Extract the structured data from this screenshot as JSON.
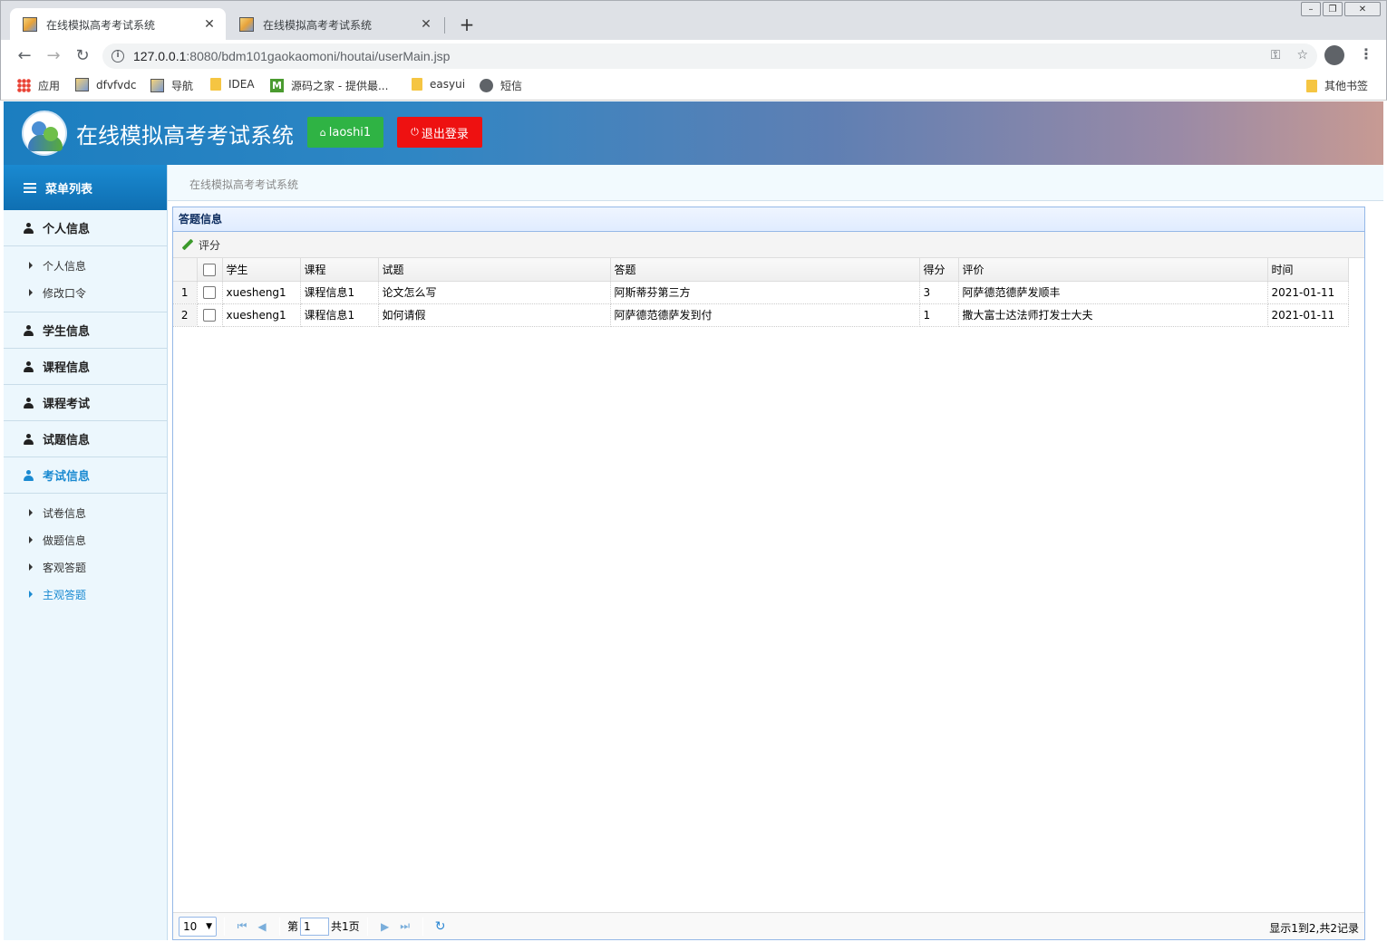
{
  "browser": {
    "tabs": [
      {
        "title": "在线模拟高考考试系统",
        "active": true
      },
      {
        "title": "在线模拟高考考试系统",
        "active": false
      }
    ],
    "url_host": "127.0.0.1",
    "url_rest": ":8080/bdm101gaokaomoni/houtai/userMain.jsp",
    "bookmarks": [
      {
        "label": "应用",
        "icon": "apps-icon"
      },
      {
        "label": "dfvfvdc",
        "icon": "page-icon"
      },
      {
        "label": "导航",
        "icon": "page-icon"
      },
      {
        "label": "IDEA",
        "icon": "folder-icon"
      },
      {
        "label": "源码之家 - 提供最...",
        "icon": "m-icon"
      },
      {
        "label": "easyui",
        "icon": "folder-icon"
      },
      {
        "label": "短信",
        "icon": "globe-icon"
      }
    ],
    "other_bookmarks": "其他书签"
  },
  "header": {
    "title": "在线模拟高考考试系统",
    "user_label": "laoshi1",
    "logout_label": "退出登录"
  },
  "sidebar": {
    "title": "菜单列表",
    "groups": [
      {
        "label": "个人信息",
        "items": [
          "个人信息",
          "修改口令"
        ]
      },
      {
        "label": "学生信息"
      },
      {
        "label": "课程信息"
      },
      {
        "label": "课程考试"
      },
      {
        "label": "试题信息"
      },
      {
        "label": "考试信息",
        "active": true,
        "items": [
          "试卷信息",
          "做题信息",
          "客观答题",
          "主观答题"
        ],
        "active_item": "主观答题"
      }
    ]
  },
  "breadcrumb": "在线模拟高考考试系统",
  "panel": {
    "title": "答题信息",
    "toolbar_button": "评分",
    "columns": [
      "学生",
      "课程",
      "试题",
      "答题",
      "得分",
      "评价",
      "时间"
    ],
    "rows": [
      {
        "num": "1",
        "cells": [
          "xuesheng1",
          "课程信息1",
          "论文怎么写",
          "阿斯蒂芬第三方",
          "3",
          "阿萨德范德萨发顺丰",
          "2021-01-11"
        ]
      },
      {
        "num": "2",
        "cells": [
          "xuesheng1",
          "课程信息1",
          "如何请假",
          "阿萨德范德萨发到付",
          "1",
          "撒大富士达法师打发士大夫",
          "2021-01-11"
        ]
      }
    ]
  },
  "pager": {
    "page_size": "10",
    "page_prefix": "第",
    "page_value": "1",
    "page_suffix": "共1页",
    "info": "显示1到2,共2记录"
  }
}
